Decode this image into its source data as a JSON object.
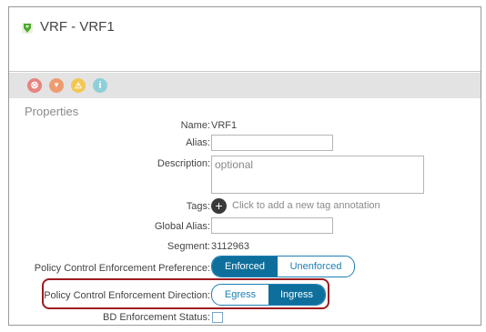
{
  "window": {
    "title": "VRF - VRF1",
    "accent": "#0e6f9c",
    "highlight_color": "#9e1b1f"
  },
  "fault_icons": [
    {
      "name": "critical-fault-icon",
      "color": "#e7847f",
      "glyph": "⊗"
    },
    {
      "name": "major-fault-icon",
      "color": "#ef9b70",
      "glyph": "▼"
    },
    {
      "name": "minor-fault-icon",
      "color": "#f3c752",
      "glyph": "⚠"
    },
    {
      "name": "warning-fault-icon",
      "color": "#8fcfd8",
      "glyph": "ⓘ"
    }
  ],
  "properties": {
    "section_title": "Properties",
    "name_label": "Name:",
    "name_value": "VRF1",
    "alias_label": "Alias:",
    "alias_value": "",
    "description_label": "Description:",
    "description_placeholder": "optional",
    "tags_label": "Tags:",
    "tags_hint": "Click to add a new tag annotation",
    "global_alias_label": "Global Alias:",
    "global_alias_value": "",
    "segment_label": "Segment:",
    "segment_value": "3112963",
    "pref_label": "Policy Control Enforcement Preference:",
    "pref_options": [
      "Enforced",
      "Unenforced"
    ],
    "pref_selected": "Enforced",
    "direction_label": "Policy Control Enforcement Direction:",
    "direction_options": [
      "Egress",
      "Ingress"
    ],
    "direction_selected": "Ingress",
    "bd_label": "BD Enforcement Status:",
    "bd_checked": false
  }
}
